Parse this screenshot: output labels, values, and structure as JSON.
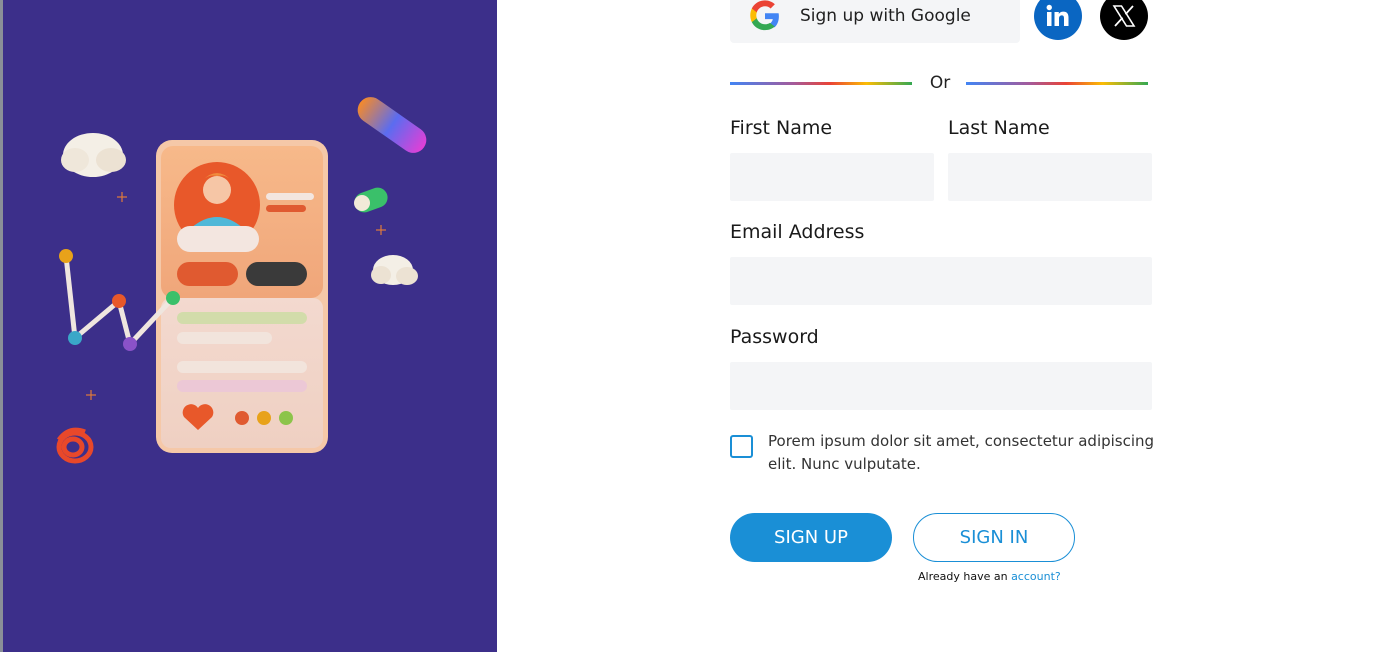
{
  "colors": {
    "hero_background": "#3c2f8a",
    "accent": "#1a8fd6",
    "input_background": "#f4f5f7",
    "linkedin": "#0a66c2",
    "x": "#000000"
  },
  "social": {
    "google_label": "Sign up with Google",
    "google_icon": "google-g-icon",
    "linkedin_icon": "linkedin-icon",
    "x_icon": "x-logo-icon"
  },
  "divider": {
    "text": "Or"
  },
  "form": {
    "first_name_label": "First Name",
    "first_name_value": "",
    "last_name_label": "Last Name",
    "last_name_value": "",
    "email_label": "Email Address",
    "email_value": "",
    "password_label": "Password",
    "password_value": "",
    "terms_text": "Porem ipsum dolor sit amet, consectetur adipiscing elit. Nunc vulputate.",
    "terms_checked": false
  },
  "actions": {
    "signup_label": "SIGN UP",
    "signin_label": "SIGN IN",
    "already_text": "Already have an ",
    "account_link": "account?"
  },
  "hero": {
    "illustration": "3d-phone-profile-illustration"
  }
}
